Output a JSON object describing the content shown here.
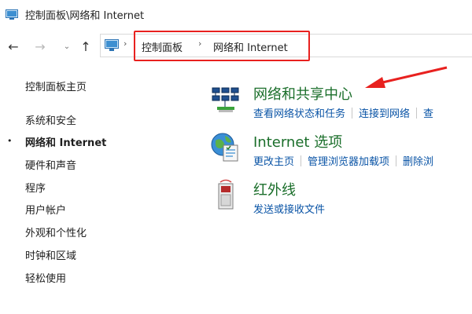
{
  "window": {
    "title": "控制面板\\网络和 Internet",
    "icon": "control-panel-icon"
  },
  "nav": {
    "back_icon": "arrow-left-icon",
    "forward_icon": "arrow-right-icon",
    "recent_icon": "chevron-down-icon",
    "up_icon": "arrow-up-icon",
    "back_glyph": "←",
    "forward_glyph": "→",
    "recent_glyph": "⌄",
    "up_glyph": "↑"
  },
  "address": {
    "sep": "›",
    "crumbs": [
      "控制面板",
      "网络和 Internet"
    ]
  },
  "sidebar": {
    "items": [
      {
        "label": "控制面板主页",
        "current": false
      },
      {
        "label": "系统和安全",
        "current": false
      },
      {
        "label": "网络和 Internet",
        "current": true
      },
      {
        "label": "硬件和声音",
        "current": false
      },
      {
        "label": "程序",
        "current": false
      },
      {
        "label": "用户帐户",
        "current": false
      },
      {
        "label": "外观和个性化",
        "current": false
      },
      {
        "label": "时钟和区域",
        "current": false
      },
      {
        "label": "轻松使用",
        "current": false
      }
    ],
    "bullet": "•"
  },
  "sections": [
    {
      "title": "网络和共享中心",
      "icon": "network-sharing-center-icon",
      "links": [
        "查看网络状态和任务",
        "连接到网络",
        "查"
      ]
    },
    {
      "title": "Internet 选项",
      "icon": "internet-options-icon",
      "links": [
        "更改主页",
        "管理浏览器加载项",
        "删除浏"
      ]
    },
    {
      "title": "红外线",
      "icon": "infrared-icon",
      "links": [
        "发送或接收文件"
      ]
    }
  ],
  "colors": {
    "section_title": "#1a6e2a",
    "link": "#0a54a6",
    "annotation": "#e8211f"
  }
}
